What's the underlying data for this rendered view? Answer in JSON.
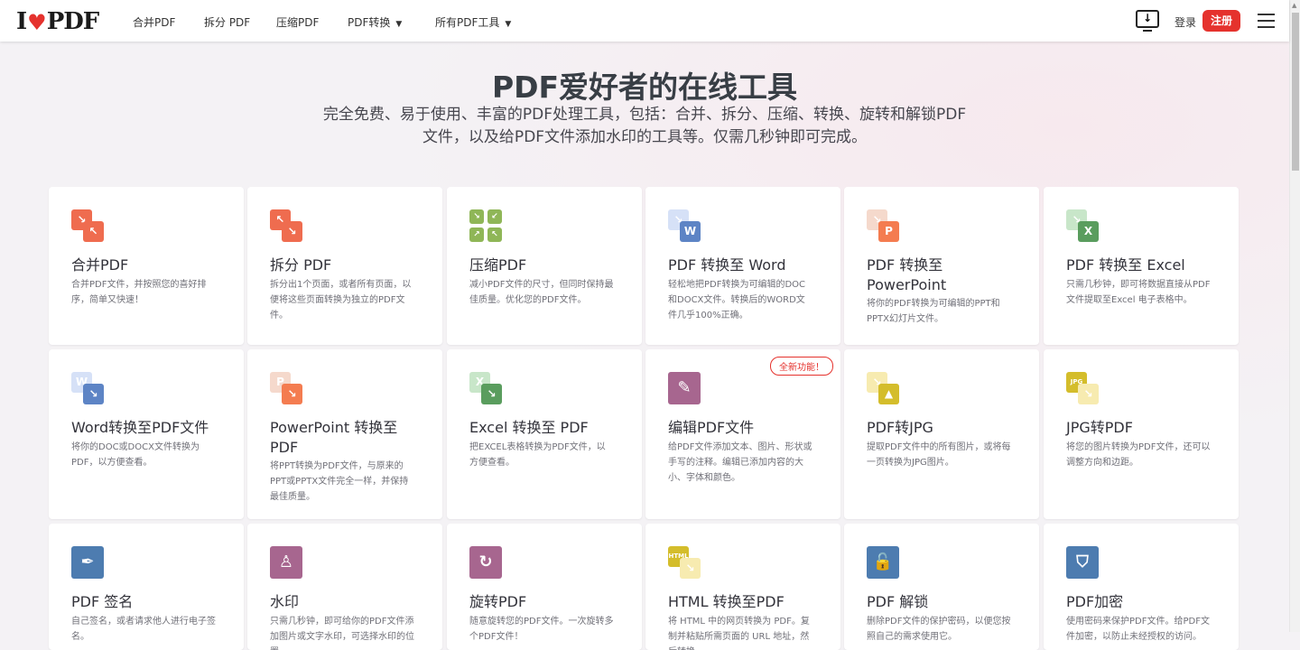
{
  "header": {
    "logo": "I♥PDF",
    "nav": [
      {
        "label": "合并PDF"
      },
      {
        "label": "拆分 PDF"
      },
      {
        "label": "压缩PDF"
      },
      {
        "label": "PDF转换",
        "dropdown": true
      },
      {
        "label": "所有PDF工具",
        "dropdown": true
      }
    ],
    "login": "登录",
    "signup": "注册"
  },
  "hero": {
    "title": "PDF爱好者的在线工具",
    "subtitle": "完全免费、易于使用、丰富的PDF处理工具，包括：合并、拆分、压缩、转换、旋转和解锁PDF文件，以及给PDF文件添加水印的工具等。仅需几秒钟即可完成。"
  },
  "tools": [
    {
      "title": "合并PDF",
      "desc": "合并PDF文件，并按照您的喜好排序，简单又快速！",
      "icon": "merge-icon",
      "type": "pair",
      "c1": "#ef6c4f",
      "c2": "#ef6c4f",
      "g1": "↘",
      "g2": "↖"
    },
    {
      "title": "拆分 PDF",
      "desc": "拆分出1个页面，或者所有页面，以便将这些页面转换为独立的PDF文件。",
      "icon": "split-icon",
      "type": "pair",
      "c1": "#ef6c4f",
      "c2": "#ef6c4f",
      "g1": "↖",
      "g2": "↘"
    },
    {
      "title": "压缩PDF",
      "desc": "减小PDF文件的尺寸，但同时保持最佳质量。优化您的PDF文件。",
      "icon": "compress-icon",
      "type": "quad",
      "c1": "#8fb657"
    },
    {
      "title": "PDF 转换至 Word",
      "desc": "轻松地把PDF转换为可编辑的DOC和DOCX文件。转换后的WORD文件几乎100%正确。",
      "icon": "pdf-to-word-icon",
      "type": "pair",
      "c1": "#d6e1f7",
      "c2": "#5d84c5",
      "g1": "↘",
      "g2": "W"
    },
    {
      "title": "PDF 转换至 PowerPoint",
      "desc": "将你的PDF转换为可编辑的PPT和PPTX幻灯片文件。",
      "icon": "pdf-to-powerpoint-icon",
      "type": "pair",
      "c1": "#f5d9cc",
      "c2": "#f47c50",
      "g1": "↘",
      "g2": "P"
    },
    {
      "title": "PDF 转换至 Excel",
      "desc": "只需几秒钟，即可将数据直接从PDF文件提取至Excel 电子表格中。",
      "icon": "pdf-to-excel-icon",
      "type": "pair",
      "c1": "#c8e6c9",
      "c2": "#5a9d5e",
      "g1": "↘",
      "g2": "X"
    },
    {
      "title": "Word转换至PDF文件",
      "desc": "将你的DOC或DOCX文件转换为PDF，以方便查看。",
      "icon": "word-to-pdf-icon",
      "type": "pair",
      "c1": "#d6e1f7",
      "c2": "#5d84c5",
      "g1": "W",
      "g2": "↘"
    },
    {
      "title": "PowerPoint 转换至 PDF",
      "desc": "将PPT转换为PDF文件，与原来的PPT或PPTX文件完全一样，并保持最佳质量。",
      "icon": "powerpoint-to-pdf-icon",
      "type": "pair",
      "c1": "#f5d9cc",
      "c2": "#f47c50",
      "g1": "P",
      "g2": "↘"
    },
    {
      "title": "Excel 转换至 PDF",
      "desc": "把EXCEL表格转换为PDF文件，以方便查看。",
      "icon": "excel-to-pdf-icon",
      "type": "pair",
      "c1": "#c8e6c9",
      "c2": "#5a9d5e",
      "g1": "X",
      "g2": "↘"
    },
    {
      "title": "编辑PDF文件",
      "desc": "给PDF文件添加文本、图片、形状或手写的注释。编辑已添加内容的大小、字体和颜色。",
      "icon": "edit-pdf-icon",
      "type": "single",
      "c1": "#a7668f",
      "g1": "✎",
      "badge": "全新功能！"
    },
    {
      "title": "PDF转JPG",
      "desc": "提取PDF文件中的所有图片，或将每一页转换为JPG图片。",
      "icon": "pdf-to-jpg-icon",
      "type": "pair",
      "c1": "#f7ebb0",
      "c2": "#d4bd2b",
      "g1": "↘",
      "g2": "▲"
    },
    {
      "title": "JPG转PDF",
      "desc": "将您的图片转换为PDF文件，还可以调整方向和边距。",
      "icon": "jpg-to-pdf-icon",
      "type": "pair",
      "c1": "#d4bd2b",
      "c2": "#f7ebb0",
      "g1": "JPG",
      "g2": "↘"
    },
    {
      "title": "PDF 签名",
      "desc": "自己签名，或者请求他人进行电子签名。",
      "icon": "sign-pdf-icon",
      "type": "single",
      "c1": "#4d7cb0",
      "g1": "✒"
    },
    {
      "title": "水印",
      "desc": "只需几秒钟，即可给你的PDF文件添加图片或文字水印，可选择水印的位置。",
      "icon": "watermark-icon",
      "type": "single",
      "c1": "#a7668f",
      "g1": "♙"
    },
    {
      "title": "旋转PDF",
      "desc": "随意旋转您的PDF文件。一次旋转多个PDF文件！",
      "icon": "rotate-pdf-icon",
      "type": "single",
      "c1": "#a7668f",
      "g1": "↻"
    },
    {
      "title": "HTML 转换至PDF",
      "desc": "将 HTML 中的网页转换为 PDF。复制并粘贴所需页面的 URL 地址，然后转换。",
      "icon": "html-to-pdf-icon",
      "type": "pair",
      "c1": "#d4bd2b",
      "c2": "#f7ebb0",
      "g1": "HTML",
      "g2": "↘"
    },
    {
      "title": "PDF 解锁",
      "desc": "删除PDF文件的保护密码，以便您按照自己的需求使用它。",
      "icon": "unlock-pdf-icon",
      "type": "single",
      "c1": "#4d7cb0",
      "g1": "🔓"
    },
    {
      "title": "PDF加密",
      "desc": "使用密码来保护PDF文件。给PDF文件加密，以防止未经授权的访问。",
      "icon": "protect-pdf-icon",
      "type": "single",
      "c1": "#4d7cb0",
      "g1": "⛉"
    }
  ]
}
